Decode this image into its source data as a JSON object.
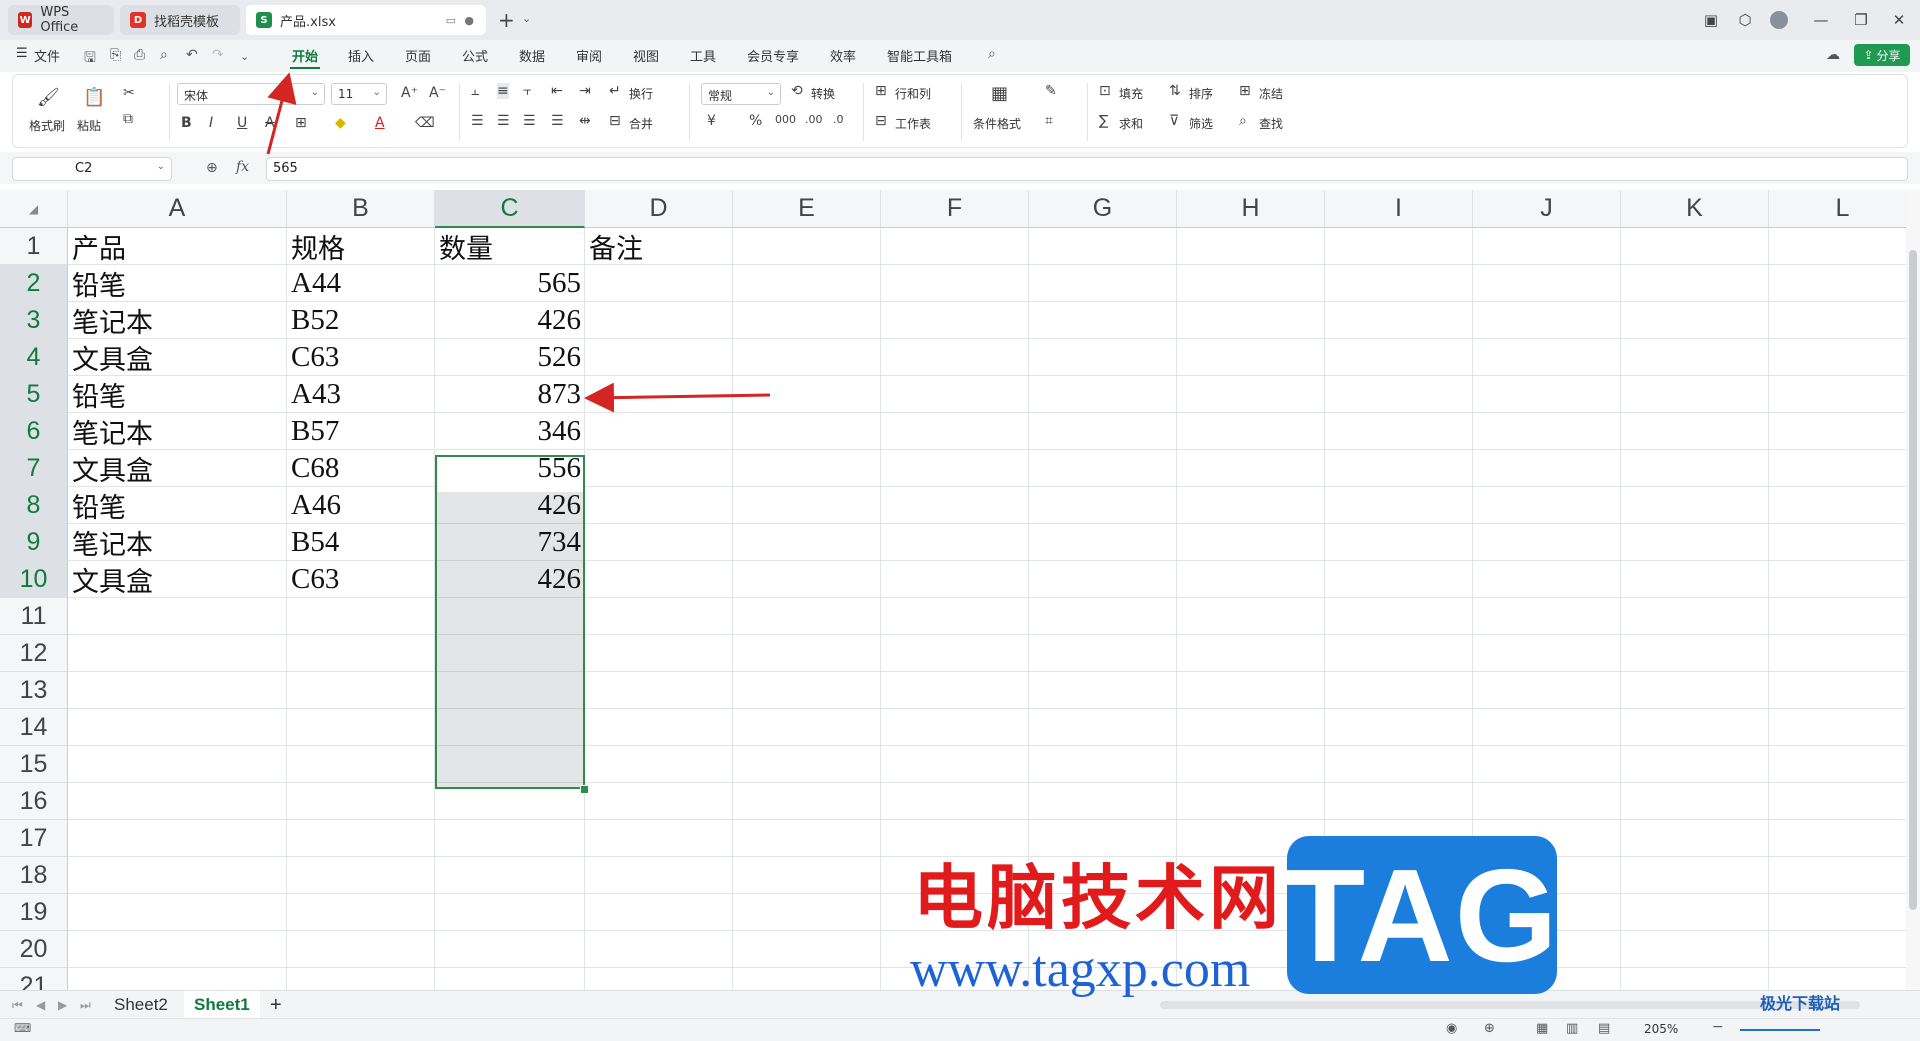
{
  "titlebar": {
    "tabs": [
      {
        "label": "WPS Office",
        "icon": "wps-logo-icon",
        "icon_color": "#d0281f"
      },
      {
        "label": "找稻壳模板",
        "icon": "docer-icon",
        "icon_color": "#e0342b"
      },
      {
        "label": "产品.xlsx",
        "icon": "spreadsheet-icon",
        "icon_color": "#1f8f4e"
      }
    ],
    "new_tab": "+"
  },
  "menubar": {
    "file_label": "文件",
    "tabs": [
      "开始",
      "插入",
      "页面",
      "公式",
      "数据",
      "审阅",
      "视图",
      "工具",
      "会员专享",
      "效率",
      "智能工具箱"
    ],
    "active_tab": "开始",
    "share_label": "分享",
    "accent_color": "#0f7b3e"
  },
  "ribbon": {
    "format_painter": "格式刷",
    "paste": "粘贴",
    "font_name": "宋体",
    "font_size": "11",
    "number_format": "常规",
    "wrap": "换行",
    "merge": "合并",
    "convert": "转换",
    "row_col": "行和列",
    "worksheet": "工作表",
    "cond_format": "条件格式",
    "fill": "填充",
    "sort": "排序",
    "freeze": "冻结",
    "sum": "求和",
    "filter": "筛选",
    "find": "查找",
    "bold": "B",
    "italic": "I",
    "underline": "U",
    "percent": "%",
    "currency": "¥"
  },
  "formulabar": {
    "cell_ref": "C2",
    "fx": "fx",
    "value": "565"
  },
  "grid": {
    "columns": [
      "A",
      "B",
      "C",
      "D",
      "E",
      "F",
      "G",
      "H",
      "I",
      "J",
      "K",
      "L"
    ],
    "rows": [
      "1",
      "2",
      "3",
      "4",
      "5",
      "6",
      "7",
      "8",
      "9",
      "10",
      "11",
      "12",
      "13",
      "14",
      "15",
      "16",
      "17",
      "18",
      "19",
      "20",
      "21"
    ],
    "data": [
      [
        "产品",
        "规格",
        "数量",
        "备注"
      ],
      [
        "铅笔",
        "A44",
        "565",
        ""
      ],
      [
        "笔记本",
        "B52",
        "426",
        ""
      ],
      [
        "文具盒",
        "C63",
        "526",
        ""
      ],
      [
        "铅笔",
        "A43",
        "873",
        ""
      ],
      [
        "笔记本",
        "B57",
        "346",
        ""
      ],
      [
        "文具盒",
        "C68",
        "556",
        ""
      ],
      [
        "铅笔",
        "A46",
        "426",
        ""
      ],
      [
        "笔记本",
        "B54",
        "734",
        ""
      ],
      [
        "文具盒",
        "C63",
        "426",
        ""
      ]
    ],
    "selected_column": "C",
    "selection_color": "#2f8c4a"
  },
  "sheets": {
    "tabs": [
      "Sheet2",
      "Sheet1"
    ],
    "active": "Sheet1",
    "add": "+"
  },
  "statusbar": {
    "zoom": "205%"
  },
  "watermark": {
    "title": "电脑技术网",
    "url": "www.tagxp.com",
    "tag": "TAG",
    "corner": "极光下载站"
  }
}
